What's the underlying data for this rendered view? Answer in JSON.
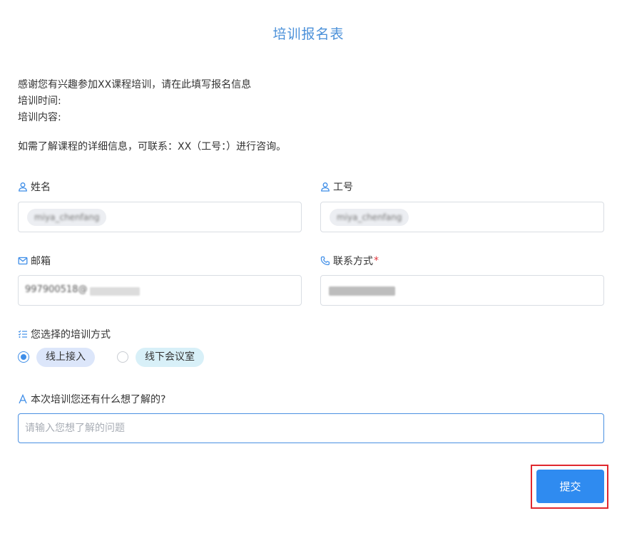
{
  "form": {
    "title": "培训报名表",
    "intro": {
      "line1": "感谢您有兴趣参加XX课程培训，请在此填写报名信息",
      "line2": "培训时间:",
      "line3": "培训内容:",
      "line4": "如需了解课程的详细信息，可联系：XX（工号：）进行咨询。"
    }
  },
  "fields": {
    "name": {
      "label": "姓名",
      "value": "miya_chenfang"
    },
    "employee_id": {
      "label": "工号",
      "value": "miya_chenfang"
    },
    "email": {
      "label": "邮箱",
      "value": "997900518@"
    },
    "contact": {
      "label": "联系方式",
      "required_mark": "*"
    },
    "training_mode": {
      "label": "您选择的培训方式",
      "options": [
        {
          "label": "线上接入",
          "selected": true,
          "color": "#dce6fa"
        },
        {
          "label": "线下会议室",
          "selected": false,
          "color": "#d8f0f8"
        }
      ]
    },
    "question": {
      "label": "本次培训您还有什么想了解的?",
      "placeholder": "请输入您想了解的问题",
      "value": ""
    }
  },
  "actions": {
    "submit_label": "提交"
  },
  "colors": {
    "accent": "#2f8bf0",
    "title": "#4a90d9",
    "required": "#e0383e",
    "highlight_border": "#e0282e"
  }
}
